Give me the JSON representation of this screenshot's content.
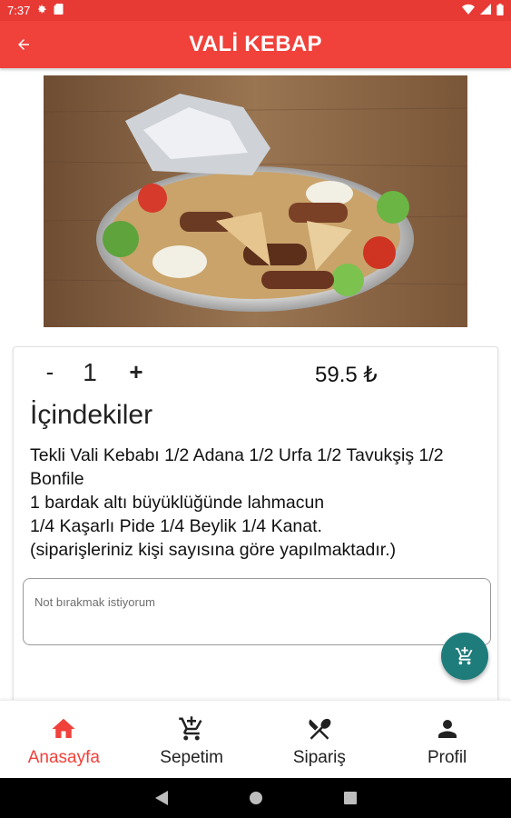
{
  "status_bar": {
    "time": "7:37"
  },
  "app_bar": {
    "title": "VALİ KEBAP"
  },
  "hero": {
    "image": "kebab-platter-photo"
  },
  "product": {
    "quantity_minus": "-",
    "quantity": "1",
    "quantity_plus": "+",
    "price": "59.5 ₺",
    "ingredients_title": "İçindekiler",
    "ingredients_text": "Tekli Vali Kebabı 1/2 Adana 1/2 Urfa 1/2 Tavukşiş 1/2 Bonfile\n1 bardak altı büyüklüğünde lahmacun\n1/4 Kaşarlı Pide 1/4 Beylik 1/4 Kanat.\n(siparişleriniz kişi sayısına göre yapılmaktadır.)",
    "note_placeholder": "Not bırakmak istiyorum"
  },
  "fab": {
    "icon": "add-to-cart-icon",
    "color": "#1e7c7b"
  },
  "bottom_nav": {
    "items": [
      {
        "label": "Anasayfa",
        "icon": "home-icon",
        "active": true
      },
      {
        "label": "Sepetim",
        "icon": "cart-add-icon",
        "active": false
      },
      {
        "label": "Sipariş",
        "icon": "utensils-icon",
        "active": false
      },
      {
        "label": "Profil",
        "icon": "person-icon",
        "active": false
      }
    ]
  },
  "colors": {
    "primary": "#f0413a",
    "status_bar": "#e83a35",
    "accent": "#1e7c7b"
  }
}
